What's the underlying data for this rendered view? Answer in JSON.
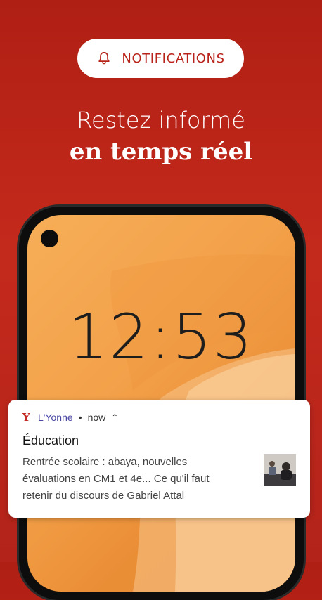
{
  "promo": {
    "pill_label": "NOTIFICATIONS",
    "headline_line1": "Restez informé",
    "headline_line2": "en temps réel"
  },
  "lockscreen": {
    "clock": "12:53"
  },
  "notification": {
    "app_logo": "Y",
    "app_name": "L'Yonne",
    "separator": "•",
    "time": "now",
    "expand_glyph": "⌃",
    "title": "Éducation",
    "body": "Rentrée scolaire : abaya, nouvelles évaluations en CM1 et 4e... Ce qu'il faut retenir du discours de Gabriel Attal"
  },
  "colors": {
    "brand_red": "#b8231a",
    "screen_orange": "#f3a14a",
    "app_name_color": "#4a47a3"
  },
  "icons": [
    "bell-icon",
    "app-logo-icon",
    "chevron-up-icon",
    "news-thumbnail"
  ]
}
